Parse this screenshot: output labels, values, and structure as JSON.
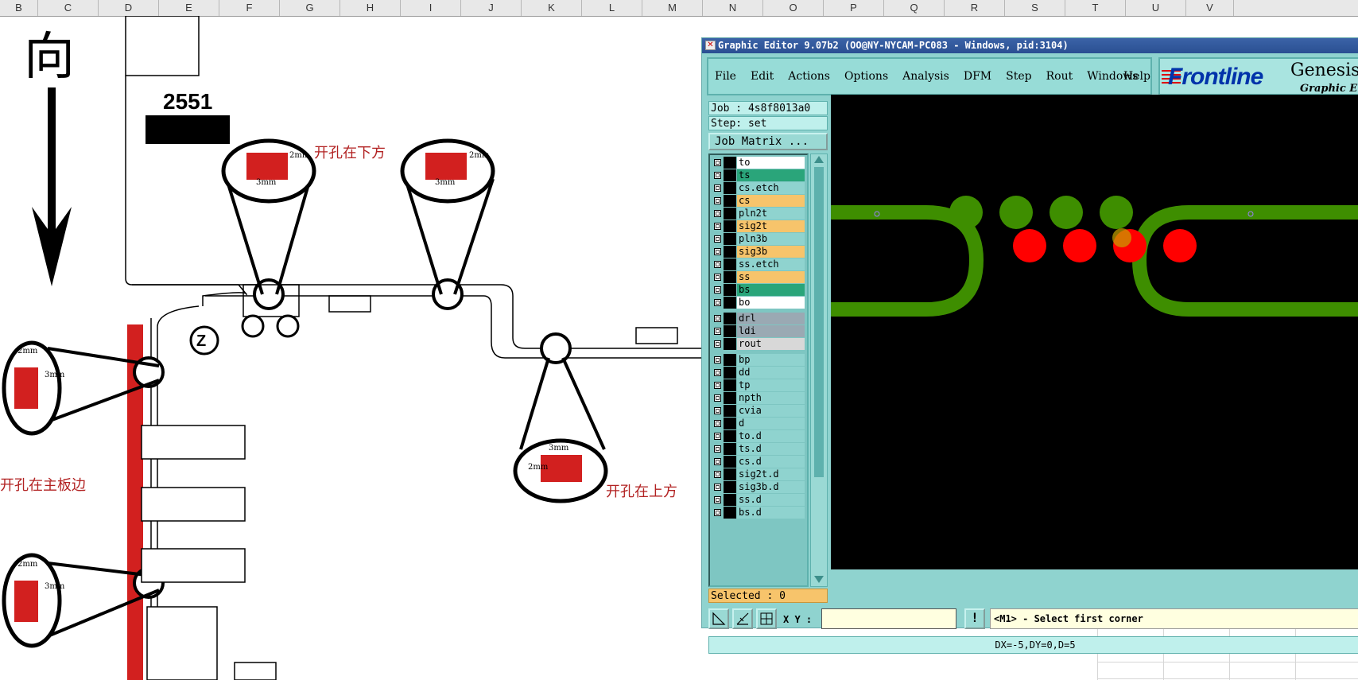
{
  "sheet": {
    "columns": [
      "B",
      "C",
      "D",
      "E",
      "F",
      "G",
      "H",
      "I",
      "J",
      "K",
      "L",
      "M",
      "N",
      "O",
      "P",
      "Q",
      "R",
      "S",
      "T",
      "U",
      "V"
    ]
  },
  "drawing": {
    "top_char": "向",
    "number": "2551",
    "note_below": "开孔在下方",
    "note_above": "开孔在上方",
    "note_edge": "开孔在主板边",
    "z_mark": "Z",
    "dim_3mm": "3mm",
    "dim_2mm": "2mm"
  },
  "editor": {
    "title": "Graphic Editor 9.07b2 (OO@NY-NYCAM-PC083 - Windows, pid:3104)",
    "menu": [
      "File",
      "Edit",
      "Actions",
      "Options",
      "Analysis",
      "DFM",
      "Step",
      "Rout",
      "Windows"
    ],
    "help": "Help",
    "brand_logo": "Frontline",
    "brand_name": "Genesis",
    "brand_sub": "Graphic E",
    "job": "Job : 4s8f8013a0",
    "step": "Step: set",
    "job_matrix": "Job Matrix ...",
    "selected": "Selected : 0",
    "xy_label": "X Y :",
    "xy_value": "",
    "bang": "!",
    "prompt": "<M1> - Select first corner",
    "status": "DX=-5,DY=0,D=5",
    "layers": [
      {
        "name": "to",
        "color": "#ffffff"
      },
      {
        "name": "ts",
        "color": "#2aa57a"
      },
      {
        "name": "cs.etch",
        "color": "#8fd3cf"
      },
      {
        "name": "cs",
        "color": "#f7c46b"
      },
      {
        "name": "pln2t",
        "color": "#8fd3cf"
      },
      {
        "name": "sig2t",
        "color": "#f7c46b"
      },
      {
        "name": "pln3b",
        "color": "#8fd3cf"
      },
      {
        "name": "sig3b",
        "color": "#f7c46b"
      },
      {
        "name": "ss.etch",
        "color": "#8fd3cf"
      },
      {
        "name": "ss",
        "color": "#f7c46b"
      },
      {
        "name": "bs",
        "color": "#2aa57a"
      },
      {
        "name": "bo",
        "color": "#ffffff"
      },
      {
        "name": "drl",
        "color": "#9aa9b3"
      },
      {
        "name": "ldi",
        "color": "#9aa9b3"
      },
      {
        "name": "rout",
        "color": "#d8d8d8"
      },
      {
        "name": "bp",
        "color": "#8fd3cf"
      },
      {
        "name": "dd",
        "color": "#8fd3cf"
      },
      {
        "name": "tp",
        "color": "#8fd3cf"
      },
      {
        "name": "npth",
        "color": "#8fd3cf"
      },
      {
        "name": "cvia",
        "color": "#8fd3cf"
      },
      {
        "name": "d",
        "color": "#8fd3cf"
      },
      {
        "name": "to.d",
        "color": "#8fd3cf"
      },
      {
        "name": "ts.d",
        "color": "#8fd3cf"
      },
      {
        "name": "cs.d",
        "color": "#8fd3cf"
      },
      {
        "name": "sig2t.d",
        "color": "#8fd3cf"
      },
      {
        "name": "sig3b.d",
        "color": "#8fd3cf"
      },
      {
        "name": "ss.d",
        "color": "#8fd3cf"
      },
      {
        "name": "bs.d",
        "color": "#8fd3cf"
      }
    ]
  }
}
